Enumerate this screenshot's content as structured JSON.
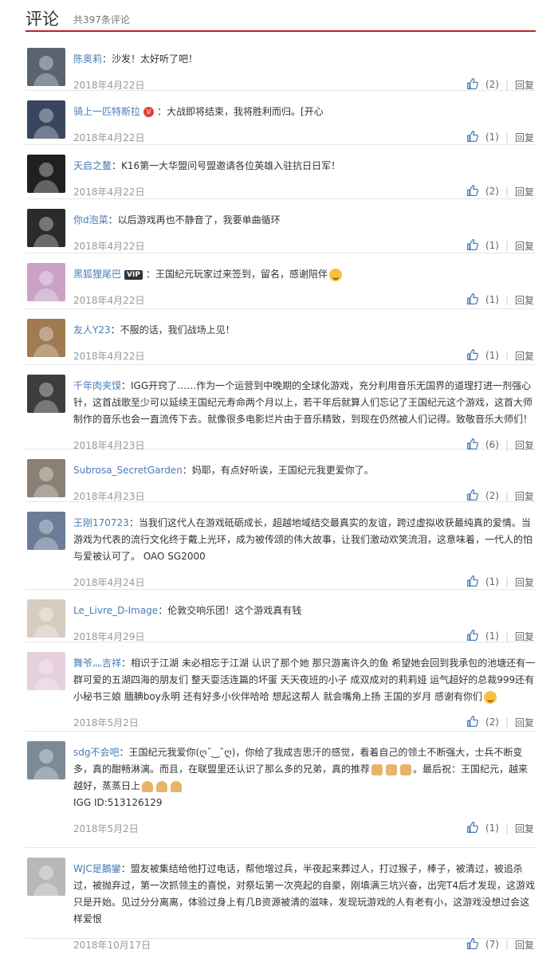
{
  "header": {
    "title": "评论",
    "count": "共397条评论"
  },
  "comments": [
    {
      "user": "陈奥莉",
      "badge": "",
      "text": "：沙发！太好听了吧！",
      "emoji": "",
      "extra": "",
      "date": "2018年4月22日",
      "likes": "(2)",
      "reply": "回复",
      "avatar_bg": "#5a6470"
    },
    {
      "user": "骑上一匹特斯拉",
      "badge": "weibo",
      "text": "：大战即将结束，我将胜利而归。[开心",
      "emoji": "",
      "extra": "",
      "date": "2018年4月22日",
      "likes": "(1)",
      "reply": "回复",
      "avatar_bg": "#3a4660"
    },
    {
      "user": "天启之鳌",
      "badge": "",
      "text": "：K16第一大华盟问号盟邀请各位英雄入驻抗日日军！",
      "emoji": "",
      "extra": "",
      "date": "2018年4月22日",
      "likes": "(2)",
      "reply": "回复",
      "avatar_bg": "#202020"
    },
    {
      "user": "你d泡菜",
      "badge": "",
      "text": "：以后游戏再也不静音了，我要单曲循环",
      "emoji": "",
      "extra": "",
      "date": "2018年4月22日",
      "likes": "(1)",
      "reply": "回复",
      "avatar_bg": "#2b2b2b"
    },
    {
      "user": "黑狐狸尾巴",
      "badge": "vip",
      "text": "：王国纪元玩家过来签到，留名，感谢陪伴",
      "emoji": "smile",
      "extra": "",
      "date": "2018年4月22日",
      "likes": "(1)",
      "reply": "回复",
      "avatar_bg": "#c9a2c6"
    },
    {
      "user": "友人Y23",
      "badge": "",
      "text": "：不服的话，我们战场上见！",
      "emoji": "",
      "extra": "",
      "date": "2018年4月22日",
      "likes": "(1)",
      "reply": "回复",
      "avatar_bg": "#a07a50"
    },
    {
      "user": "千年肉夹馍",
      "badge": "",
      "text": "：IGG开窍了……作为一个运营到中晚期的全球化游戏，充分利用音乐无国界的道理打进一剂强心针，这首战歌至少可以延续王国纪元寿命两个月以上，若干年后就算人们忘记了王国纪元这个游戏，这首大师制作的音乐也会一直流传下去。就像很多电影烂片由于音乐精致，到现在仍然被人们记得。致敬音乐大师们！",
      "emoji": "",
      "extra": "",
      "date": "2018年4月23日",
      "likes": "(6)",
      "reply": "回复",
      "avatar_bg": "#3d3d3d"
    },
    {
      "user": "Subrosa_SecretGarden",
      "badge": "",
      "text": "：妈耶，有点好听诶，王国纪元我更爱你了。",
      "emoji": "",
      "extra": "",
      "date": "2018年4月23日",
      "likes": "(2)",
      "reply": "回复",
      "avatar_bg": "#8c8075"
    },
    {
      "user": "王刚170723",
      "badge": "",
      "text": "：当我们这代人在游戏砥砺成长，超越地域结交最真实的友谊，跨过虚拟收获最纯真的爱情。当游戏为代表的流行文化终于戴上光环，成为被传颂的伟大故事，让我们激动欢笑流泪，这意味着，一代人的怕与爱被认可了。 OAO SG2000",
      "emoji": "",
      "extra": "",
      "date": "2018年4月24日",
      "likes": "(1)",
      "reply": "回复",
      "avatar_bg": "#6a7d96"
    },
    {
      "user": "Le_Livre_D-Image",
      "badge": "",
      "text": "：伦敦交响乐团！这个游戏真有钱",
      "emoji": "",
      "extra": "",
      "date": "2018年4月29日",
      "likes": "(1)",
      "reply": "回复",
      "avatar_bg": "#d8ccc0"
    },
    {
      "user": "舞爷灬吉祥",
      "badge": "",
      "text": "：相识于江湖 未必相忘于江湖 认识了那个她 那只游离许久的鱼 希望她会回到我承包的池塘还有一群可爱的五湖四海的朋友们 整天耍活连篇的坏蛋 天天夜班的小子 成双成对的莉莉娅 运气超好的总裁999还有小秘书三娘 腼腆boy永明 还有好多小伙伴哈哈 想起这帮人 就会嘴角上扬 王国的岁月 感谢有你们",
      "emoji": "smile",
      "extra": "",
      "date": "2018年5月2日",
      "likes": "(2)",
      "reply": "回复",
      "avatar_bg": "#e6d0dc"
    },
    {
      "user": "sdg不会吧",
      "badge": "",
      "text": "：王国纪元我爱你(ღ˘‿˘ღ)，你给了我成吉思汗的感觉，看着自己的领土不断强大，士兵不断变多，真的酣畅淋漓。而且，在联盟里还认识了那么多的兄弟，真的推荐",
      "emoji": "thumbs",
      "text2": "。最后祝：王国纪元，越来越好，蒸蒸日上",
      "emoji2": "pray",
      "extra": "IGG ID:513126129",
      "date": "2018年5月2日",
      "likes": "(1)",
      "reply": "回复",
      "avatar_bg": "#7b8a99"
    },
    {
      "user": "WJC是鵝鑾",
      "badge": "",
      "text": "：盟友被集结给他打过电话，帮他增过兵，半夜起来葬过人，打过猴子，棒子，被清过，被追杀过，被抛弃过，第一次抓领主的喜悦，对祭坛第一次亮起的自豪，刚填满三坑兴奋，出完T4后才发现，这游戏只是开始。见过分分离离，体验过身上有几B资源被清的滋味，发现玩游戏的人有老有小，这游戏没想过会这样爱恨",
      "emoji": "",
      "extra": "",
      "date": "2018年10月17日",
      "likes": "(7)",
      "reply": "回复",
      "avatar_bg": "#b8b8b8"
    }
  ]
}
